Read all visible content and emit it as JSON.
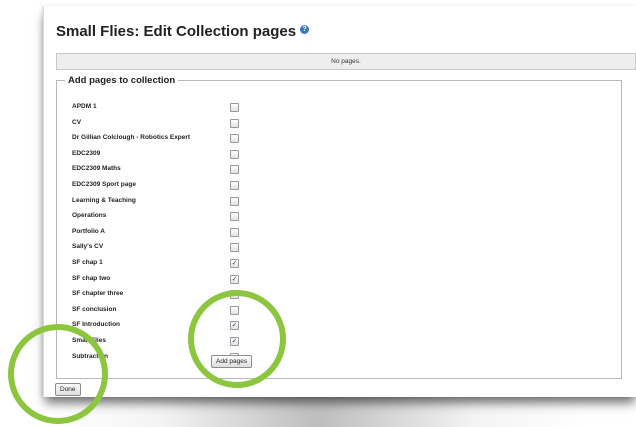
{
  "page": {
    "title": "Small Flies: Edit Collection pages",
    "help_icon": "info-icon",
    "notice": "No pages.",
    "fieldset_legend": "Add pages to collection",
    "add_button_label": "Add pages",
    "done_button_label": "Done"
  },
  "pages": [
    {
      "label": "APDM 1",
      "checked": false
    },
    {
      "label": "CV",
      "checked": false
    },
    {
      "label": "Dr Gillian Colclough - Robotics Expert",
      "checked": false
    },
    {
      "label": "EDC2309",
      "checked": false
    },
    {
      "label": "EDC2309 Maths",
      "checked": false
    },
    {
      "label": "EDC2309 Sport page",
      "checked": false
    },
    {
      "label": "Learning & Teaching",
      "checked": false
    },
    {
      "label": "Operations",
      "checked": false
    },
    {
      "label": "Portfolio A",
      "checked": false
    },
    {
      "label": "Sally's CV",
      "checked": false
    },
    {
      "label": "SF chap 1",
      "checked": true
    },
    {
      "label": "SF chap two",
      "checked": true
    },
    {
      "label": "SF chapter three",
      "checked": true
    },
    {
      "label": "SF conclusion",
      "checked": false
    },
    {
      "label": "SF Introduction",
      "checked": true
    },
    {
      "label": "Small Flies",
      "checked": true
    },
    {
      "label": "Subtraction",
      "checked": false
    }
  ],
  "colors": {
    "highlight_ring": "#8cc63f",
    "checkmark": "#2b4f9a"
  }
}
